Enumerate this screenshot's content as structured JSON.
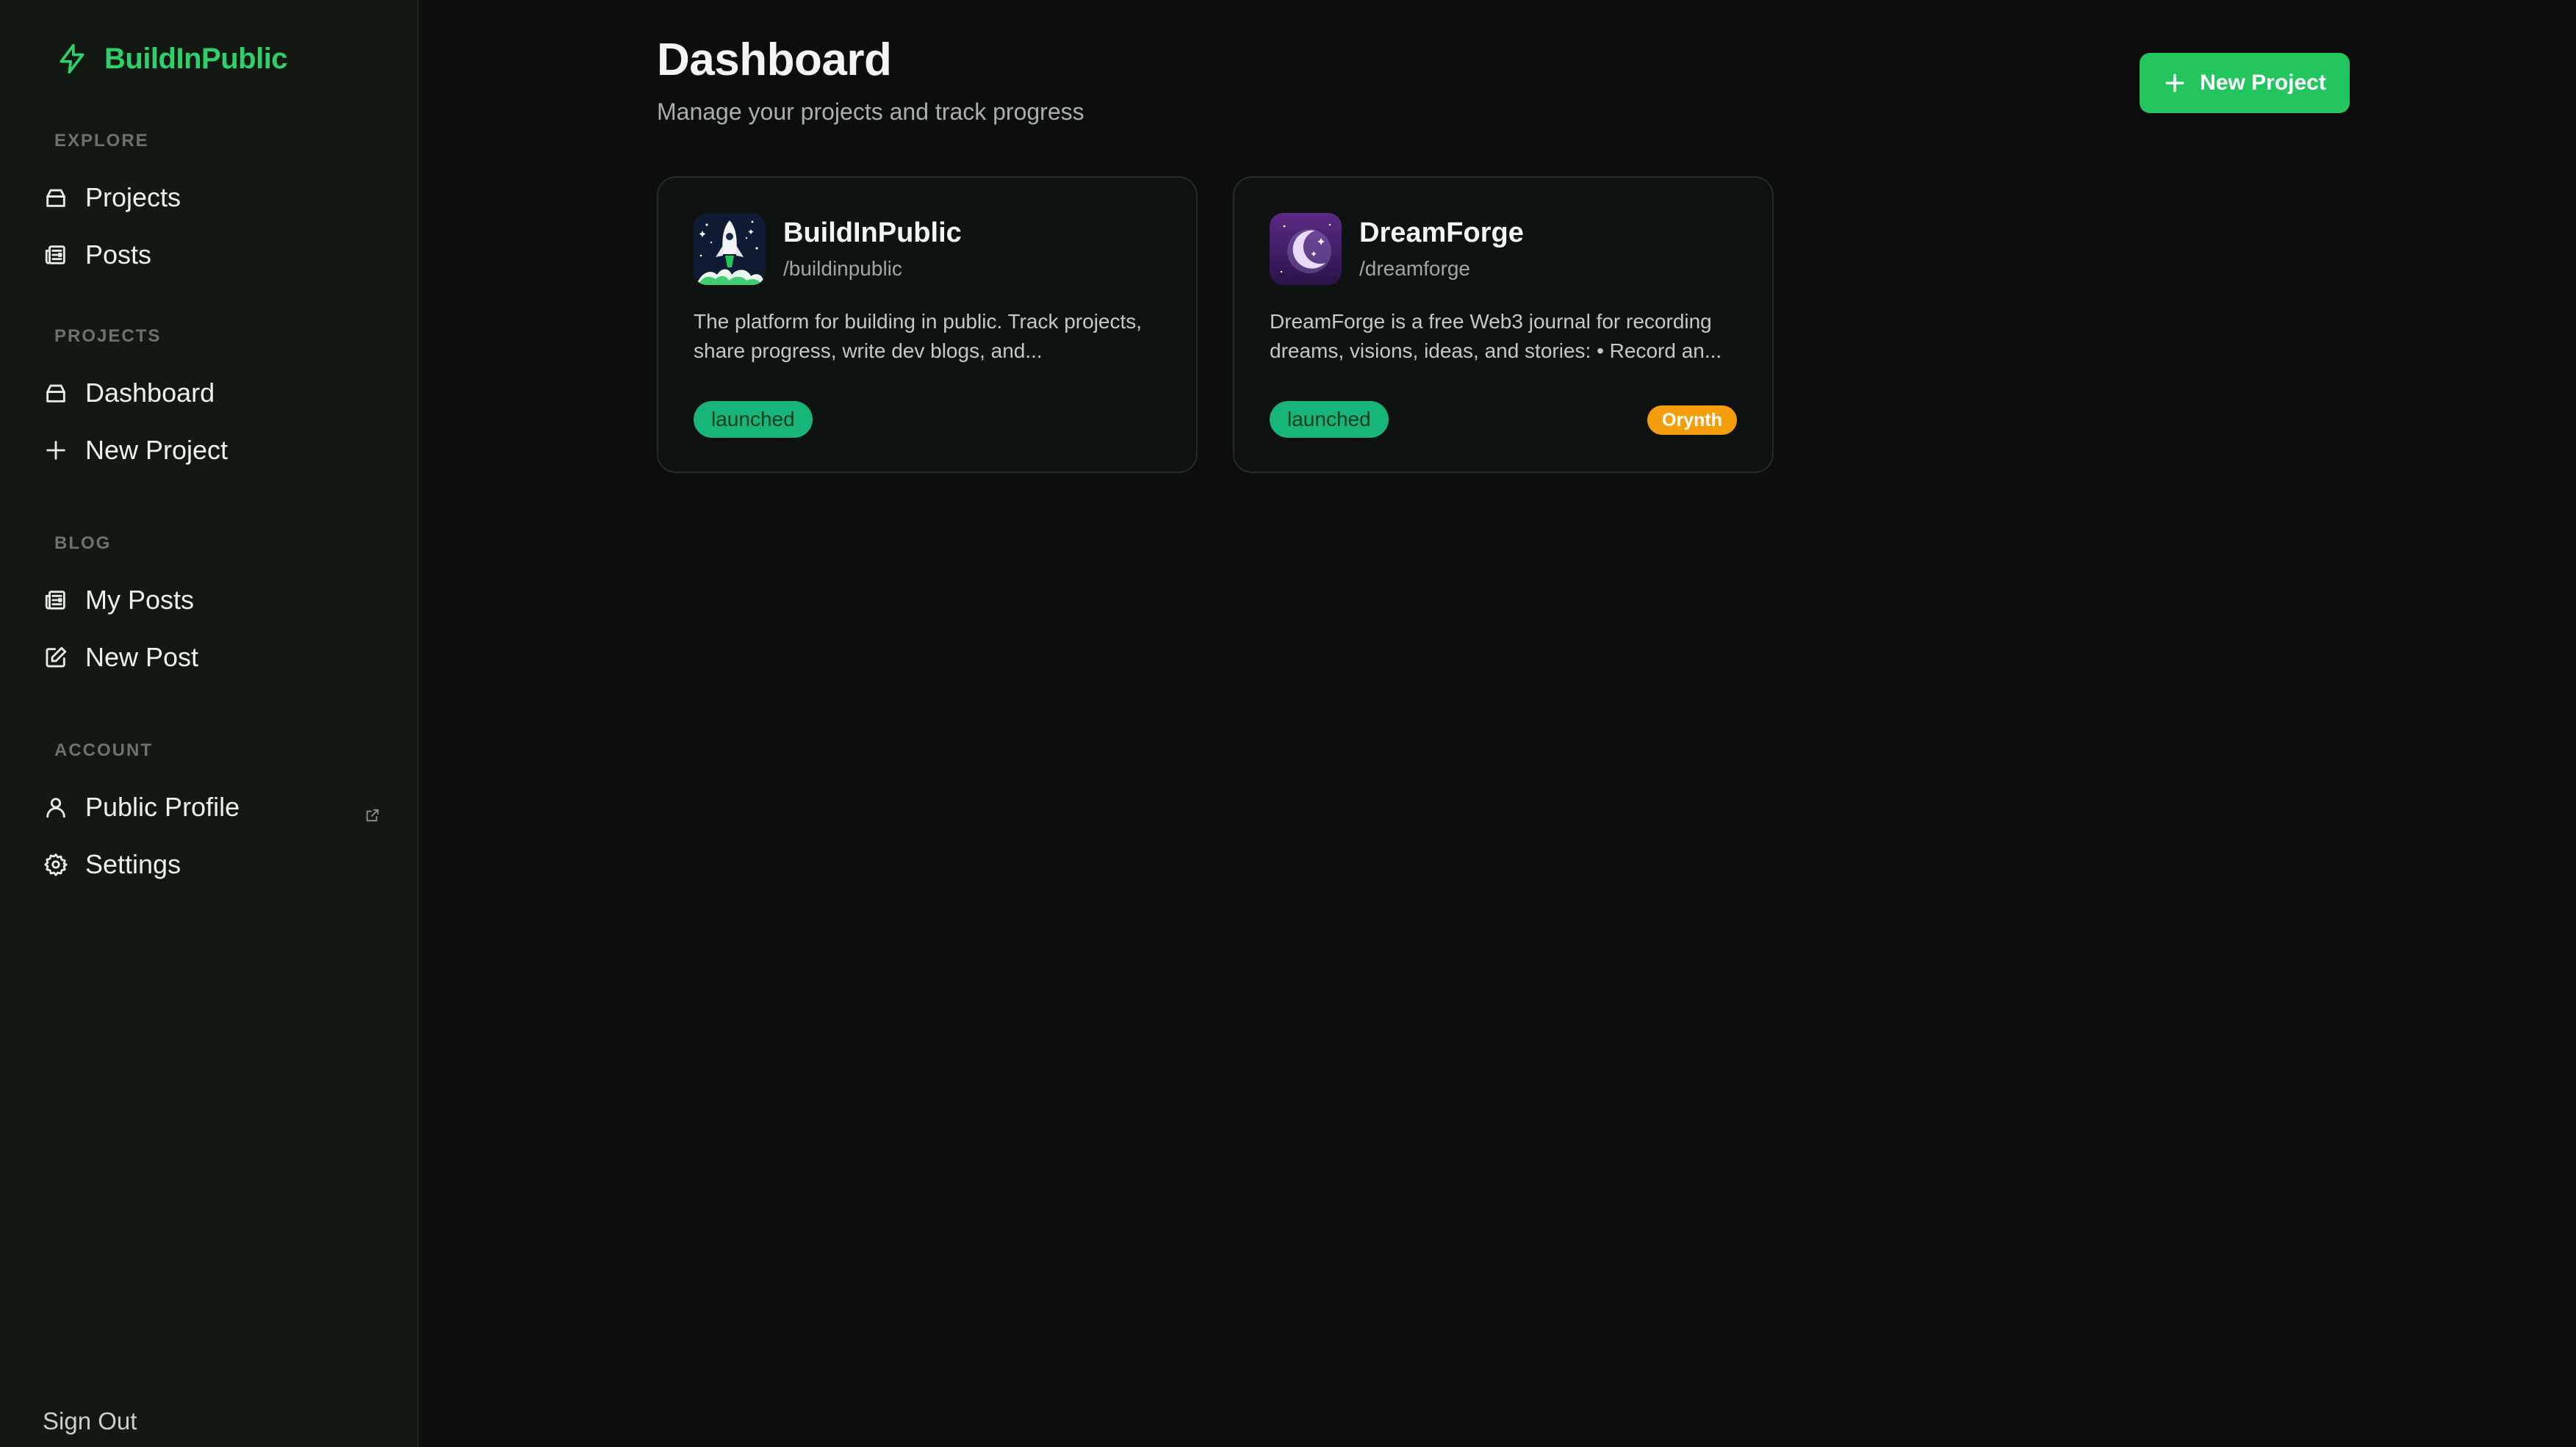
{
  "app": {
    "brand_name": "BuildInPublic",
    "brand_icon": "lightning-icon",
    "accent_color": "#22c55e"
  },
  "sidebar": {
    "sections": [
      {
        "label": "EXPLORE",
        "items": [
          {
            "label": "Projects",
            "icon": "box-icon"
          },
          {
            "label": "Posts",
            "icon": "newspaper-icon"
          }
        ]
      },
      {
        "label": "PROJECTS",
        "items": [
          {
            "label": "Dashboard",
            "icon": "box-icon"
          },
          {
            "label": "New Project",
            "icon": "plus-icon"
          }
        ]
      },
      {
        "label": "BLOG",
        "items": [
          {
            "label": "My Posts",
            "icon": "newspaper-icon"
          },
          {
            "label": "New Post",
            "icon": "edit-icon"
          }
        ]
      },
      {
        "label": "ACCOUNT",
        "items": [
          {
            "label": "Public Profile",
            "icon": "user-icon",
            "external": true
          },
          {
            "label": "Settings",
            "icon": "gear-icon"
          }
        ]
      }
    ],
    "sign_out_label": "Sign Out"
  },
  "main": {
    "title": "Dashboard",
    "subtitle": "Manage your projects and track progress",
    "new_project_label": "New Project",
    "projects": [
      {
        "name": "BuildInPublic",
        "slug": "/buildinpublic",
        "description": "The platform for building in public. Track projects, share progress, write dev blogs, and...",
        "status": "launched",
        "logo": "rocket-logo"
      },
      {
        "name": "DreamForge",
        "slug": "/dreamforge",
        "description": "DreamForge is a free Web3 journal for recording dreams, visions, ideas, and stories: • Record an...",
        "status": "launched",
        "tag": "Orynth",
        "logo": "moon-logo"
      }
    ]
  }
}
